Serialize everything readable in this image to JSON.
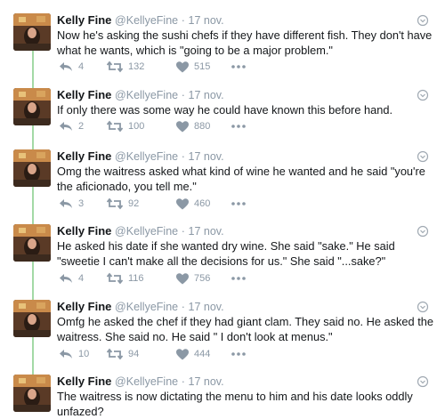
{
  "author": {
    "name": "Kelly Fine",
    "handle": "@KellyeFine",
    "separator": "·",
    "date": "17 nov."
  },
  "colors": {
    "thread_line": "#a3d9a6",
    "muted": "#8b98a5",
    "text": "#14171a"
  },
  "icons": {
    "reply": "reply-icon",
    "retweet": "retweet-icon",
    "like": "heart-icon",
    "more": "more-dots-icon",
    "menu": "chevron-down-icon"
  },
  "tweets": [
    {
      "text": "Now he's asking the sushi chefs if they have different fish. They don't have what he wants, which is \"going to be a major problem.\"",
      "replies": "4",
      "retweets": "132",
      "likes": "515"
    },
    {
      "text": "If only there was some way he could have known this before hand.",
      "replies": "2",
      "retweets": "100",
      "likes": "880"
    },
    {
      "text": "Omg the waitress asked what kind of wine he wanted and he said \"you're the aficionado, you tell me.\"",
      "replies": "3",
      "retweets": "92",
      "likes": "460"
    },
    {
      "text": "He asked his date if she wanted dry wine. She said \"sake.\" He said \"sweetie I can't make all the decisions for us.\" She said \"...sake?\"",
      "replies": "4",
      "retweets": "116",
      "likes": "756"
    },
    {
      "text": "Omfg he asked the chef if they had giant clam. They said no. He asked the waitress. She said no. He said \" I don't look at menus.\"",
      "replies": "10",
      "retweets": "94",
      "likes": "444"
    },
    {
      "text": "The waitress is now dictating the menu to him and his date looks oddly unfazed?"
    }
  ]
}
